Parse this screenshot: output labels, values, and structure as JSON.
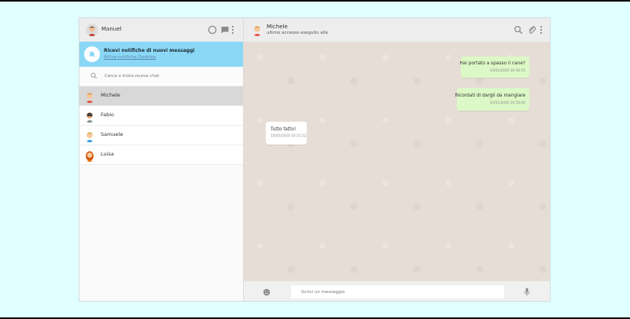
{
  "user": {
    "name": "Manuel",
    "avatar_icon": "man-avatar-icon"
  },
  "left_header_icons": [
    "status-icon",
    "chat-icon",
    "menu-dots-icon"
  ],
  "notification": {
    "title": "Ricevi notifiche di nuovi messaggi",
    "link": "Attiva notifiche Desktop",
    "icon": "bell-off-icon"
  },
  "search": {
    "placeholder": "Cerca o inizia nuova chat",
    "icon": "search-icon"
  },
  "chats": [
    {
      "name": "Michele",
      "active": true
    },
    {
      "name": "Fabio",
      "active": false
    },
    {
      "name": "Samuele",
      "active": false
    },
    {
      "name": "Luisa",
      "active": false
    }
  ],
  "conversation": {
    "name": "Michele",
    "status": "ultimo accesso eseguito alle",
    "header_icons": [
      "search-icon",
      "paperclip-icon",
      "menu-dots-icon"
    ]
  },
  "messages": [
    {
      "direction": "out",
      "text": "Hai portato a spasso il cane?",
      "time": "10/01/2020 16:30:55"
    },
    {
      "direction": "out",
      "text": "Ricordati di dargli da mangiare",
      "time": "10/01/2020 16:56:00"
    },
    {
      "direction": "in",
      "text": "Tutto fatto!",
      "time": "10/01/2020 16:15:22"
    }
  ],
  "composer": {
    "placeholder": "Scrivi un messaggio",
    "emoji_icon": "emoji-icon",
    "mic_icon": "microphone-icon"
  },
  "colors": {
    "notification_bg": "#8bd7f6",
    "outgoing_bubble": "#dcf8c6",
    "incoming_bubble": "#ffffff",
    "active_chat": "#d8d8d8",
    "page_bg": "#e0ffff"
  }
}
